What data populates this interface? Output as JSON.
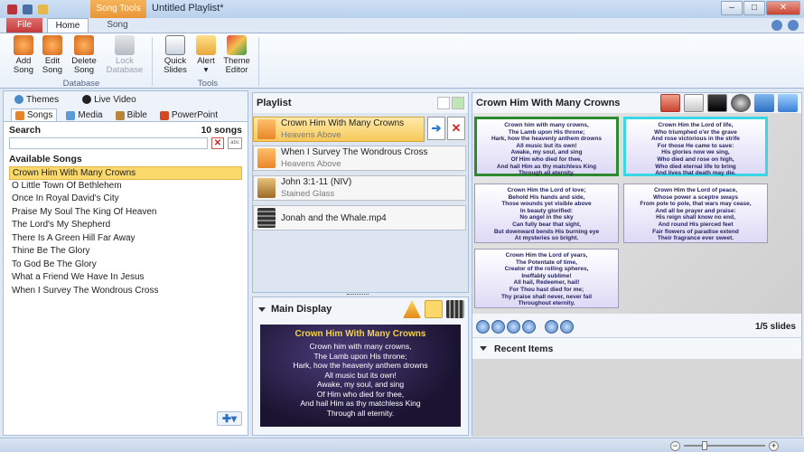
{
  "window": {
    "title": "Untitled Playlist*",
    "context_tab": "Song Tools",
    "controls": [
      "–",
      "□",
      "✕"
    ]
  },
  "ribbon": {
    "tabs": {
      "file": "File",
      "home": "Home",
      "song": "Song"
    },
    "database": {
      "label": "Database",
      "buttons": [
        {
          "line1": "Add",
          "line2": "Song",
          "icon": "add-song-icon",
          "color": "#e8852a"
        },
        {
          "line1": "Edit",
          "line2": "Song",
          "icon": "edit-song-icon",
          "color": "#e8852a"
        },
        {
          "line1": "Delete",
          "line2": "Song",
          "icon": "delete-song-icon",
          "color": "#e8852a"
        },
        {
          "line1": "Lock",
          "line2": "Database",
          "icon": "lock-database-icon",
          "color": "#9aa2ad",
          "disabled": true
        }
      ]
    },
    "tools": {
      "label": "Tools",
      "buttons": [
        {
          "line1": "Quick",
          "line2": "Slides",
          "icon": "quick-slides-icon"
        },
        {
          "line1": "Alert",
          "line2": "▾",
          "icon": "alert-icon"
        },
        {
          "line1": "Theme",
          "line2": "Editor",
          "icon": "theme-editor-icon"
        }
      ]
    }
  },
  "library": {
    "tabs_top": [
      {
        "label": "Themes",
        "icon": "themes-icon"
      },
      {
        "label": "Live Video",
        "icon": "live-video-icon"
      }
    ],
    "tabs_bottom": [
      {
        "label": "Songs",
        "icon": "songs-icon",
        "active": true
      },
      {
        "label": "Media",
        "icon": "media-icon"
      },
      {
        "label": "Bible",
        "icon": "bible-icon"
      },
      {
        "label": "PowerPoint",
        "icon": "powerpoint-icon"
      }
    ],
    "search_label": "Search",
    "song_count": "10 songs",
    "search_value": "",
    "available_label": "Available Songs",
    "songs": [
      "Crown Him With Many Crowns",
      "O Little Town Of Bethlehem",
      "Once In Royal David's City",
      "Praise My Soul The King Of Heaven",
      "The Lord's My Shepherd",
      "There Is A Green Hill Far Away",
      "Thine Be The Glory",
      "To God Be The Glory",
      "What a Friend We Have In Jesus",
      "When I Survey The Wondrous Cross"
    ],
    "selected_song_index": 0
  },
  "playlist": {
    "title": "Playlist",
    "items": [
      {
        "title": "Crown Him With Many Crowns",
        "subtitle": "Heavens Above",
        "icon": "song-note-icon",
        "selected": true
      },
      {
        "title": "When I Survey The Wondrous Cross",
        "subtitle": "Heavens Above",
        "icon": "song-note-icon"
      },
      {
        "title": "John 3:1-11 (NIV)",
        "subtitle": "Stained Glass",
        "icon": "bible-icon"
      },
      {
        "title": "Jonah and the Whale.mp4",
        "subtitle": "",
        "icon": "video-film-icon"
      }
    ]
  },
  "main_display": {
    "title": "Main Display",
    "preview_title": "Crown Him With Many Crowns",
    "preview_lines": [
      "Crown him with many crowns,",
      "The Lamb upon His throne;",
      "Hark, how the heavenly anthem drowns",
      "All music but its own!",
      "Awake, my soul, and sing",
      "Of Him who died for thee,",
      "And hail Him as thy matchless King",
      "Through all eternity."
    ]
  },
  "slides_panel": {
    "title": "Crown Him With Many Crowns",
    "slides": [
      [
        "Crown him with many crowns,",
        "The Lamb upon His throne;",
        "Hark, how the heavenly anthem drowns",
        "All music but its own!",
        "Awake, my soul, and sing",
        "Of Him who died for thee,",
        "And hail Him as thy matchless King",
        "Through all eternity."
      ],
      [
        "Crown Him the Lord of life,",
        "Who triumphed o'er the grave",
        "And rose victorious in the strife",
        "For those He came to save:",
        "His glories now we sing,",
        "Who died and rose on high,",
        "Who died eternal life to bring",
        "And lives that death may die."
      ],
      [
        "Crown Him the Lord of love;",
        "Behold His hands and side,",
        "Those wounds yet visible above",
        "In beauty glorified:",
        "No angel in the sky",
        "Can fully bear that sight,",
        "But downward bends His burning eye",
        "At mysteries so bright."
      ],
      [
        "Crown Him the Lord of peace,",
        "Whose power a sceptre sways",
        "From pole to pole, that wars may cease,",
        "And all be prayer and praise:",
        "His reign shall know no end,",
        "And round His pierced feet",
        "Fair flowers of paradise extend",
        "Their fragrance ever sweet."
      ],
      [
        "Crown Him the Lord of years,",
        "The Potentate of time,",
        "Creator of the rolling spheres,",
        "Ineffably sublime!",
        "All hail, Redeemer, hail!",
        "For Thou hast died for me;",
        "Thy praise shall never, never fail",
        "Throughout eternity."
      ]
    ],
    "slide_count": "1/5 slides",
    "recent_label": "Recent Items"
  },
  "colors": {
    "selected_song": "#fbd86a",
    "active_slide_border": "#2e8a2e",
    "next_slide_border": "#3cd7e7",
    "preview_title": "#f4d24a"
  }
}
